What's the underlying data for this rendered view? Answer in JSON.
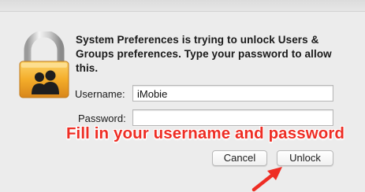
{
  "dialog": {
    "message": "System Preferences is trying to unlock Users & Groups preferences. Type your password to allow this.",
    "icon": "lock-with-users-icon"
  },
  "form": {
    "username_label": "Username:",
    "username_value": "iMobie",
    "password_label": "Password:",
    "password_value": ""
  },
  "annotation": {
    "text": "Fill in your username and password",
    "color": "#ee2d24",
    "arrow_icon": "red-arrow-icon"
  },
  "buttons": {
    "cancel_label": "Cancel",
    "unlock_label": "Unlock"
  }
}
